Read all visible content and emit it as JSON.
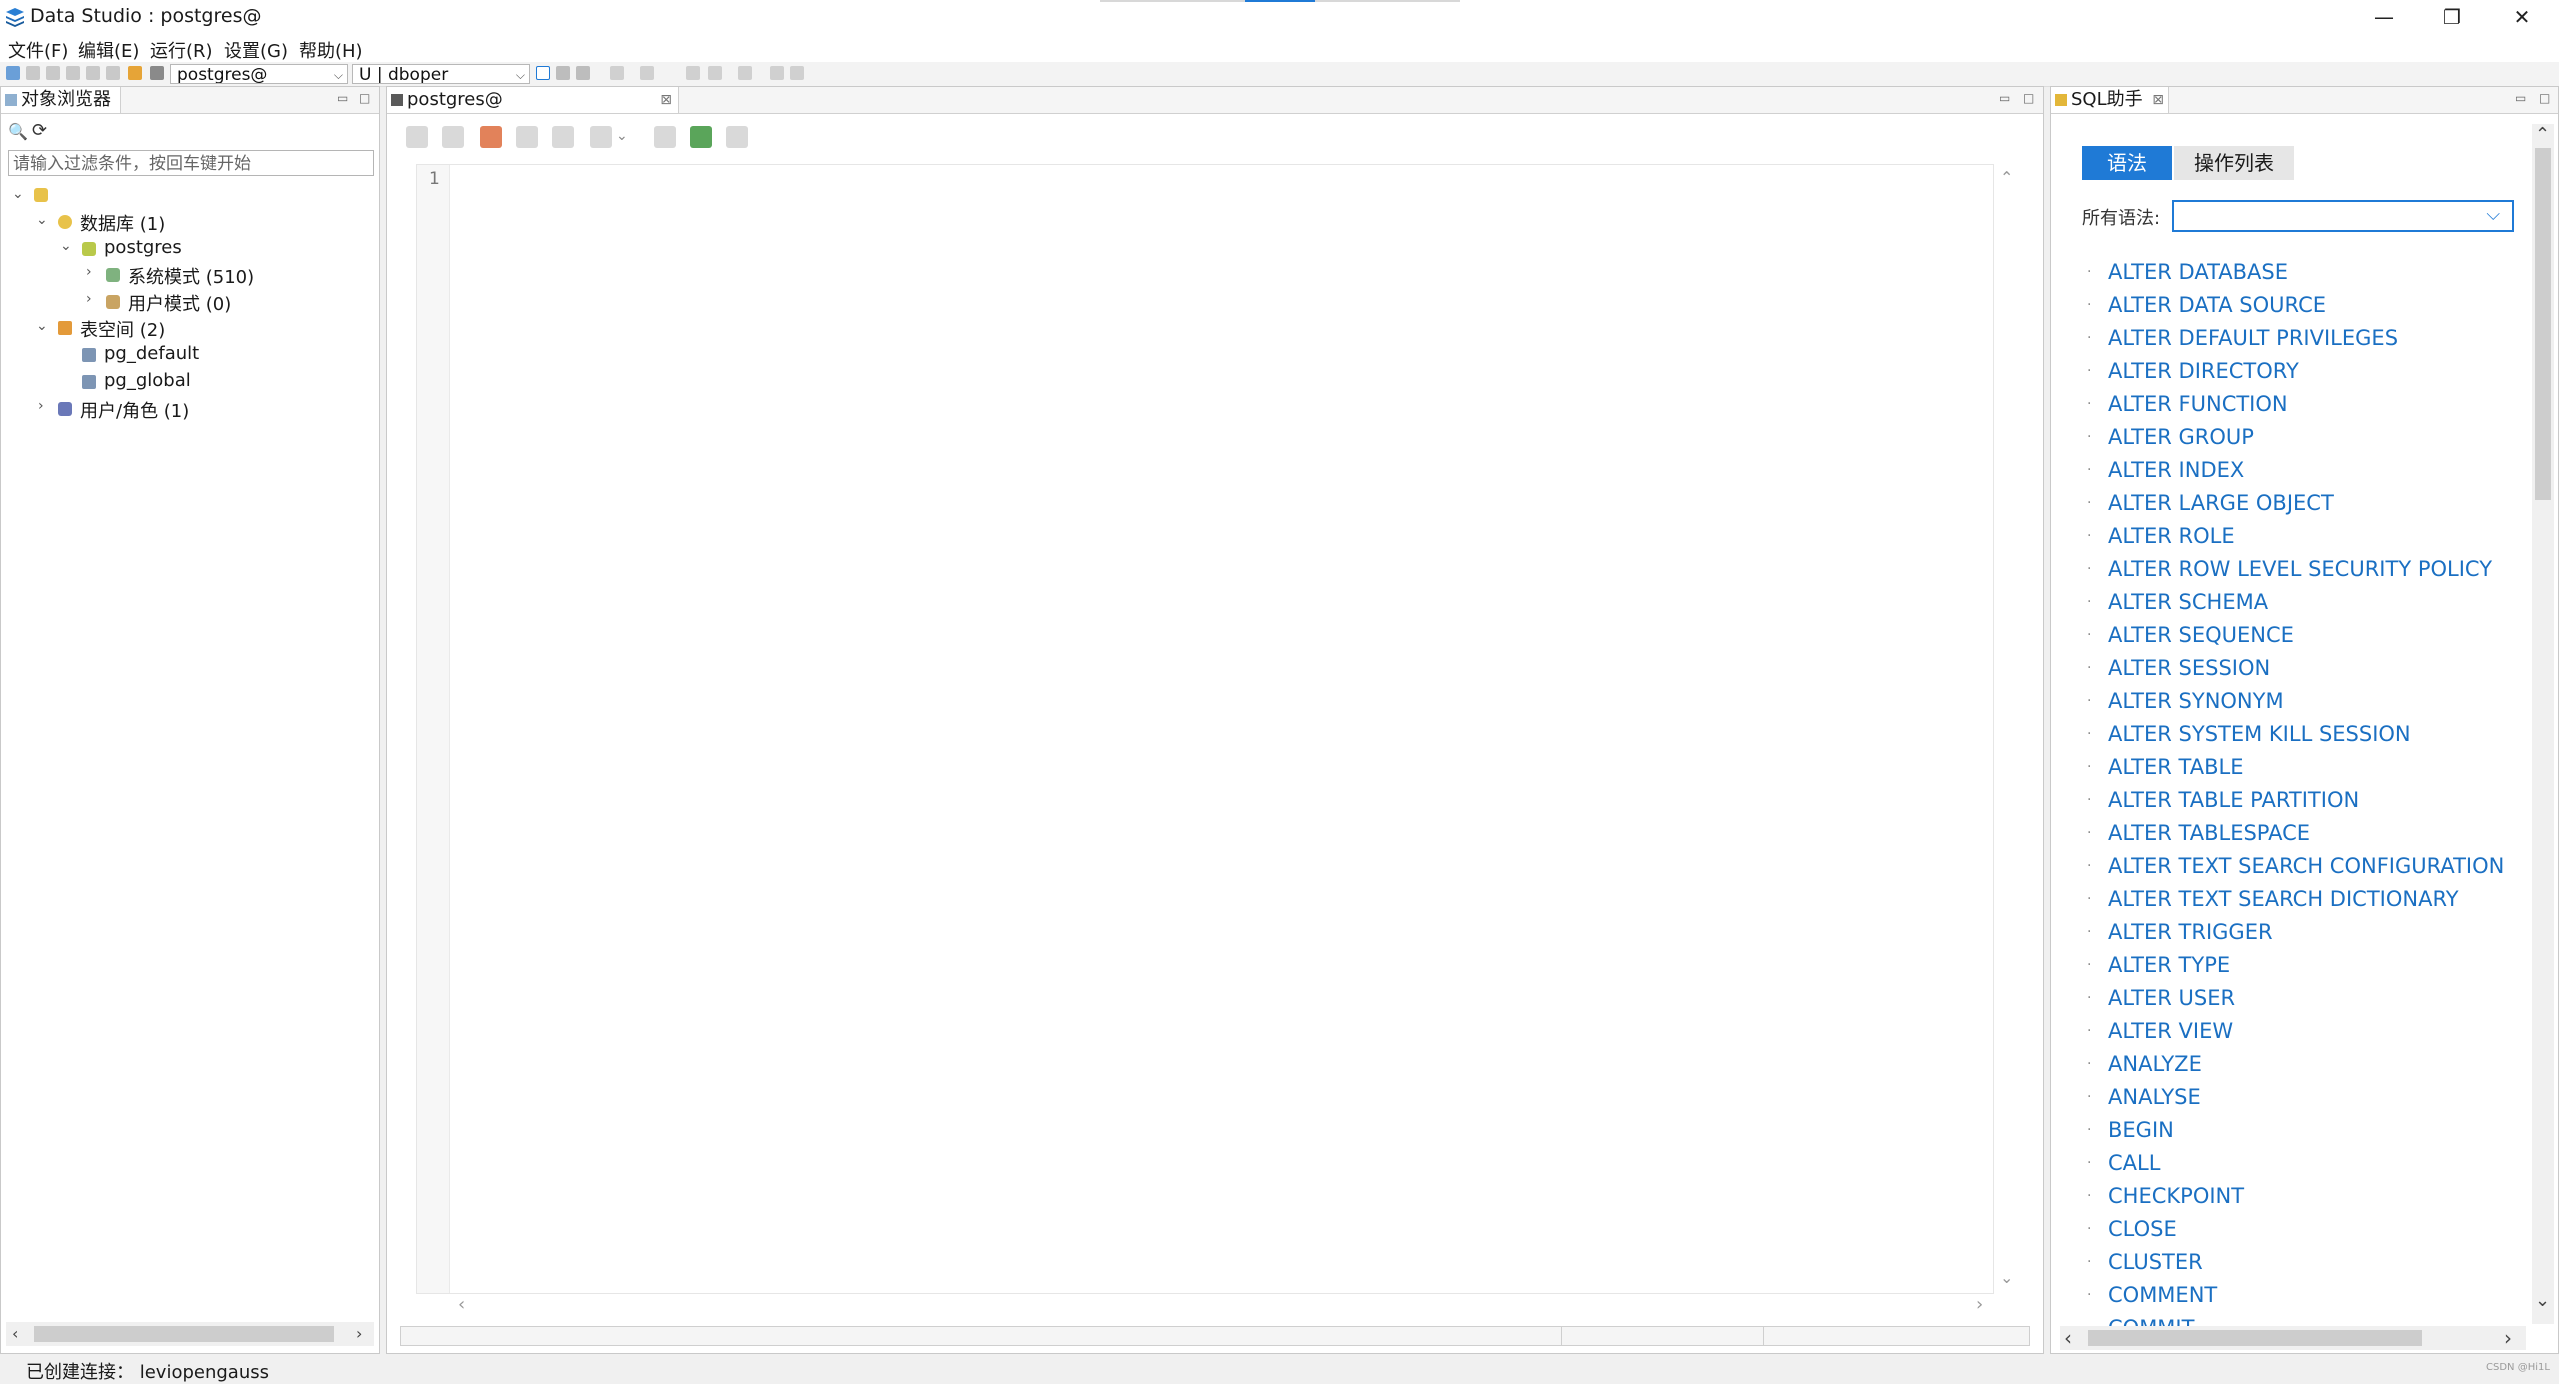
{
  "window": {
    "title": "Data Studio : postgres@",
    "controls": [
      "—",
      "❐",
      "✕"
    ]
  },
  "menu": [
    "文件(F)",
    "编辑(E)",
    "运行(R)",
    "设置(G)",
    "帮助(H)"
  ],
  "toolbar": {
    "connection_combo": "postgres@",
    "schema_combo": "U | dboper"
  },
  "object_browser": {
    "tab_label": "对象浏览器",
    "filter_placeholder": "请输入过滤条件，按回车键开始",
    "tree": {
      "databases": "数据库 (1)",
      "postgres": "postgres",
      "system_schemas": "系统模式 (510)",
      "user_schemas": "用户模式 (0)",
      "tablespaces": "表空间 (2)",
      "pg_default": "pg_default",
      "pg_global": "pg_global",
      "users_roles": "用户/角色 (1)"
    }
  },
  "editor": {
    "tab_label": "postgres@",
    "line_number": "1"
  },
  "sql_assistant": {
    "tab_label": "SQL助手",
    "tabs": [
      "语法",
      "操作列表"
    ],
    "filter_label": "所有语法:",
    "items": [
      "ALTER DATABASE",
      "ALTER DATA SOURCE",
      "ALTER DEFAULT PRIVILEGES",
      "ALTER DIRECTORY",
      "ALTER FUNCTION",
      "ALTER GROUP",
      "ALTER INDEX",
      "ALTER LARGE OBJECT",
      "ALTER ROLE",
      "ALTER ROW LEVEL SECURITY POLICY",
      "ALTER SCHEMA",
      "ALTER SEQUENCE",
      "ALTER SESSION",
      "ALTER SYNONYM",
      "ALTER SYSTEM KILL SESSION",
      "ALTER TABLE",
      "ALTER TABLE PARTITION",
      "ALTER TABLESPACE",
      "ALTER TEXT SEARCH CONFIGURATION",
      "ALTER TEXT SEARCH DICTIONARY",
      "ALTER TRIGGER",
      "ALTER TYPE",
      "ALTER USER",
      "ALTER VIEW",
      "ANALYZE",
      "ANALYSE",
      "BEGIN",
      "CALL",
      "CHECKPOINT",
      "CLOSE",
      "CLUSTER",
      "COMMENT",
      "COMMIT"
    ]
  },
  "status": {
    "text": "已创建连接： leviopengauss",
    "watermark": "CSDN @Hi1L"
  },
  "colors": {
    "link": "#1a6fc2",
    "tab_active": "#1f7ad6"
  }
}
